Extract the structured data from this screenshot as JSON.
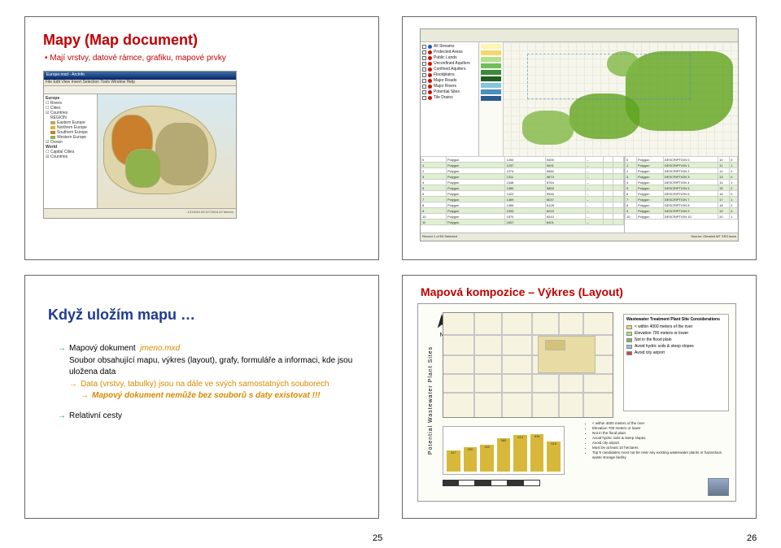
{
  "slide1": {
    "title": "Mapy (Map document)",
    "bullet": "Mají vrstvy, datové rámce, grafiku, mapové prvky",
    "arcmap": {
      "titlebar": "Europe.mxd - ArcInfo",
      "menu": "File  Edit  View  Insert  Selection  Tools  Window  Help",
      "toc": {
        "frame": "Europe",
        "layers": [
          "Rivers",
          "Cities",
          "Countries",
          "REGION"
        ],
        "regions": [
          "Eastern Europe",
          "Northern Europe",
          "Southern Europe",
          "Western Europe"
        ],
        "layers2": [
          "Ocean",
          "World",
          "Capital Cities",
          "Countries"
        ]
      },
      "status": "-1311084.08  5272804.42 Meters"
    }
  },
  "slide2": {
    "toc_items": [
      {
        "label": "All Streams",
        "color": "#1b5fae"
      },
      {
        "label": "Protected Areas",
        "color": "#c10"
      },
      {
        "label": "Public Lands",
        "color": "#c10"
      },
      {
        "label": "Unconfined Aquifers",
        "color": "#c10"
      },
      {
        "label": "Confined Aquifers",
        "color": "#c10"
      },
      {
        "label": "Floodplains",
        "color": "#c10"
      },
      {
        "label": "Major Roads",
        "color": "#c10"
      },
      {
        "label": "Major Rivers",
        "color": "#c10"
      },
      {
        "label": "Potential Sites",
        "color": "#c10"
      },
      {
        "label": "Tile Drains",
        "color": "#c10"
      }
    ],
    "legend_colors": [
      "#fdf6b2",
      "#f5d76e",
      "#b4e08a",
      "#6fbf5b",
      "#3a8b3a",
      "#1f5f1f",
      "#86c5e0",
      "#4a90c1",
      "#2a5d8f"
    ],
    "table_rows": [
      "Polygon",
      "Polygon",
      "Polygon",
      "Polygon",
      "Polygon",
      "Polygon",
      "Polygon",
      "Polygon",
      "Polygon",
      "Polygon",
      "Polygon",
      "Polygon"
    ],
    "selinfo_rows": [
      "Polygon",
      "Polygon",
      "Polygon",
      "Polygon",
      "Polygon",
      "Polygon",
      "Polygon",
      "Polygon",
      "Polygon",
      "Polygon",
      "Polygon"
    ],
    "status_left": "Record  1 of 53   Selected",
    "status_right": "Source: Olmsted MT SSS team"
  },
  "slide3": {
    "title": "Když uložím mapu …",
    "l1_prefix": "Mapový dokument",
    "l1_file": "jmeno.mxd",
    "l2": "Soubor obsahující mapu, výkres (layout), grafy, formuláře a informaci, kde jsou uložena data",
    "l3": "Data (vrstvy, tabulky) jsou na dále ve svých samostatných souborech",
    "l4": "Mapový dokument nemůže bez souborů s daty existovat !!!",
    "l5": "Relativní cesty"
  },
  "slide4": {
    "title": "Mapová kompozice – Výkres (Layout)",
    "sidebar": "Potential Wastewater Plant Sites",
    "legend": {
      "header": "Wastewater Treatment Plant Site Considerations",
      "items": [
        "< within 4000 meters of the river",
        "Elevation 700 meters or lower",
        "Not in the flood plain",
        "Avoid hydric soils & steep slopes",
        "Avoid city airport",
        "Must be at least 10 hectares",
        "Top 5 candidates must not be near any existing wastewater plants or hazardous waste storage facility"
      ]
    },
    "chart_data": {
      "type": "bar",
      "categories": [
        "247",
        "390",
        "145",
        "585",
        "614",
        "616",
        "619"
      ],
      "values": [
        35,
        40,
        45,
        55,
        60,
        62,
        50
      ],
      "ylim": [
        0,
        70
      ],
      "title": "",
      "xlabel": "",
      "ylabel": ""
    }
  },
  "page_left": "25",
  "page_right": "26"
}
